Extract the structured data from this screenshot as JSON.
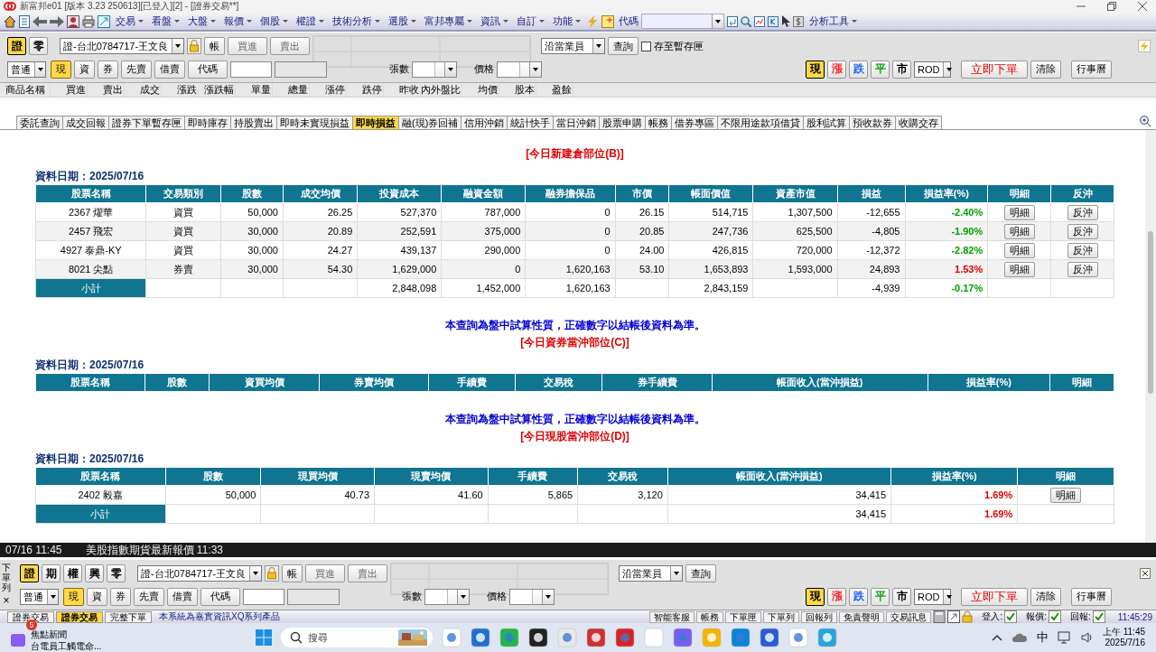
{
  "window": {
    "title": "新富邦e01 [版本 3.23 250613][已登入][2] - [證券交易**]"
  },
  "menubar": {
    "items": [
      "交易",
      "看盤",
      "大盤",
      "報價",
      "個股",
      "權證",
      "技術分析",
      "選股",
      "富邦專屬",
      "資訊",
      "自訂",
      "功能"
    ],
    "code_label": "代碼",
    "tools": "分析工具"
  },
  "order_panels": [
    {
      "markets": [
        {
          "label": "證",
          "selected": true
        },
        {
          "label": "零",
          "selected": false
        }
      ],
      "account": "證-台北0784717-王文良",
      "account_button": "帳",
      "buy": "買進",
      "sell": "賣出",
      "salesperson": "沿當業員",
      "query": "查詢",
      "save_draft": {
        "label": "存至暫存匣",
        "checked": false
      },
      "order_type": "普通",
      "trade_types": [
        {
          "label": "現",
          "selected": true
        },
        {
          "label": "資",
          "selected": false
        },
        {
          "label": "券",
          "selected": false
        },
        {
          "label": "先賣",
          "selected": false
        },
        {
          "label": "借賣",
          "selected": false
        }
      ],
      "code_button": "代碼",
      "qty_label": "張數",
      "price_label": "價格",
      "price_types": [
        {
          "label": "現",
          "selected": true,
          "color": "#000000"
        },
        {
          "label": "漲",
          "selected": false,
          "color": "#ff2020"
        },
        {
          "label": "跌",
          "selected": false,
          "color": "#2060ff"
        },
        {
          "label": "平",
          "selected": false,
          "color": "#10a010"
        },
        {
          "label": "市",
          "selected": false,
          "color": "#000000"
        }
      ],
      "tif": "ROD",
      "submit": "立即下單",
      "clear": "清除",
      "calendar": "行事曆"
    },
    {
      "label": "下單列",
      "close": "×",
      "markets": [
        {
          "label": "證",
          "selected": true
        },
        {
          "label": "期",
          "selected": false
        },
        {
          "label": "權",
          "selected": false
        },
        {
          "label": "興",
          "selected": false
        },
        {
          "label": "零",
          "selected": false
        }
      ],
      "account": "證-台北0784717-王文良",
      "account_button": "帳",
      "buy": "買進",
      "sell": "賣出",
      "salesperson": "沿當業員",
      "query": "查詢",
      "order_type": "普通",
      "trade_types": [
        {
          "label": "現",
          "selected": true
        },
        {
          "label": "資",
          "selected": false
        },
        {
          "label": "券",
          "selected": false
        },
        {
          "label": "先賣",
          "selected": false
        },
        {
          "label": "借賣",
          "selected": false
        }
      ],
      "code_button": "代碼",
      "qty_label": "張數",
      "price_label": "價格",
      "price_types": [
        {
          "label": "現",
          "selected": true,
          "color": "#000000"
        },
        {
          "label": "漲",
          "selected": false,
          "color": "#ff2020"
        },
        {
          "label": "跌",
          "selected": false,
          "color": "#2060ff"
        },
        {
          "label": "平",
          "selected": false,
          "color": "#10a010"
        },
        {
          "label": "市",
          "selected": false,
          "color": "#000000"
        }
      ],
      "tif": "ROD",
      "submit": "立即下單",
      "clear": "清除",
      "calendar": "行事曆"
    }
  ],
  "quote_columns": [
    "商品名稱",
    "買進",
    "賣出",
    "成交",
    "漲跌",
    "漲跌幅",
    "單量",
    "總量",
    "漲停",
    "跌停",
    "昨收",
    "內外盤比",
    "均價",
    "股本",
    "盈餘"
  ],
  "tabs": [
    {
      "label": "委託查詢",
      "selected": false
    },
    {
      "label": "成交回報",
      "selected": false
    },
    {
      "label": "證券下單暫存匣",
      "selected": false
    },
    {
      "label": "即時庫存",
      "selected": false
    },
    {
      "label": "持股賣出",
      "selected": false
    },
    {
      "label": "即時未實現損益",
      "selected": false
    },
    {
      "label": "即時損益",
      "selected": true
    },
    {
      "label": "融(現)券回補",
      "selected": false
    },
    {
      "label": "信用沖銷",
      "selected": false
    },
    {
      "label": "統計快手",
      "selected": false
    },
    {
      "label": "當日沖銷",
      "selected": false
    },
    {
      "label": "股票申購",
      "selected": false
    },
    {
      "label": "帳務",
      "selected": false
    },
    {
      "label": "借券專區",
      "selected": false
    },
    {
      "label": "不限用途款項借貸",
      "selected": false
    },
    {
      "label": "股利試算",
      "selected": false
    },
    {
      "label": "預收款券",
      "selected": false
    },
    {
      "label": "收購交存",
      "selected": false
    }
  ],
  "sections": [
    {
      "title": "[今日新建倉部位(B)]",
      "date": "資料日期：2025/07/16",
      "columns": [
        "股票名稱",
        "交易類別",
        "股數",
        "成交均價",
        "投資成本",
        "融資金額",
        "融券擔保品",
        "市價",
        "帳面價值",
        "資產市值",
        "損益",
        "損益率(%)",
        "明細",
        "反沖"
      ],
      "rows": [
        {
          "cells": [
            "2367 燿華",
            "資買",
            "50,000",
            "26.25",
            "527,370",
            "787,000",
            "0",
            "26.15",
            "514,715",
            "1,307,500",
            "-12,655",
            "-2.40%"
          ],
          "color": "#00a000",
          "buttons": [
            "明細",
            "反沖"
          ]
        },
        {
          "cells": [
            "2457 飛宏",
            "資買",
            "30,000",
            "20.89",
            "252,591",
            "375,000",
            "0",
            "20.85",
            "247,736",
            "625,500",
            "-4,805",
            "-1.90%"
          ],
          "color": "#00a000",
          "buttons": [
            "明細",
            "反沖"
          ]
        },
        {
          "cells": [
            "4927 泰鼎-KY",
            "資買",
            "30,000",
            "24.27",
            "439,137",
            "290,000",
            "0",
            "24.00",
            "426,815",
            "720,000",
            "-12,372",
            "-2.82%"
          ],
          "color": "#00a000",
          "buttons": [
            "明細",
            "反沖"
          ]
        },
        {
          "cells": [
            "8021 尖點",
            "券賣",
            "30,000",
            "54.30",
            "1,629,000",
            "0",
            "1,620,163",
            "53.10",
            "1,653,893",
            "1,593,000",
            "24,893",
            "1.53%"
          ],
          "color": "#e00000",
          "buttons": [
            "明細",
            "反沖"
          ]
        }
      ],
      "subtotal": {
        "cells": [
          "小計",
          null,
          null,
          null,
          "2,848,098",
          "1,452,000",
          "1,620,163",
          null,
          "2,843,159",
          null,
          "-4,939",
          "-0.17%",
          null,
          null
        ],
        "color": "#00a000"
      }
    },
    {
      "notice": "本查詢為盤中試算性質，正確數字以結帳後資料為準。",
      "title": "[今日資券當沖部位(C)]",
      "date": "資料日期：2025/07/16",
      "columns": [
        "股票名稱",
        "股數",
        "資買均價",
        "券賣均價",
        "手續費",
        "交易稅",
        "券手續費",
        "帳面收入(當沖損益)",
        "損益率(%)",
        "明細"
      ]
    },
    {
      "notice": "本查詢為盤中試算性質，正確數字以結帳後資料為準。",
      "title": "[今日現股當沖部位(D)]",
      "date": "資料日期：2025/07/16",
      "columns": [
        "股票名稱",
        "股數",
        "現買均價",
        "現賣均價",
        "手續費",
        "交易稅",
        "帳面收入(當沖損益)",
        "損益率(%)",
        "明細"
      ],
      "rows": [
        {
          "cells": [
            "2402 毅嘉",
            "50,000",
            "40.73",
            "41.60",
            "5,865",
            "3,120",
            "34,415",
            "1.69%"
          ],
          "color": "#e00000",
          "buttons": [
            "明細"
          ]
        }
      ],
      "subtotal": {
        "cells": [
          "小計",
          null,
          null,
          null,
          null,
          null,
          "34,415",
          "1.69%",
          null
        ],
        "color": "#e00000"
      }
    }
  ],
  "ticker": {
    "time": "07/16 11:45",
    "text": "美股指數期貨最新報價 11:33"
  },
  "bottom_tabs": [
    {
      "label": "證券交易",
      "selected": false
    },
    {
      "label": "證券交易",
      "selected": true
    },
    {
      "label": "完整下單",
      "selected": false
    }
  ],
  "bottom_info": "本系統為嘉實資訊XQ系列產品",
  "bottom_buttons": [
    "智能客服",
    "帳務",
    "下單匣",
    "下單列",
    "回報列",
    "免責聲明",
    "交易訊息"
  ],
  "indicators": [
    {
      "label": "登入:"
    },
    {
      "label": "報價:"
    },
    {
      "label": "回報:"
    }
  ],
  "clock": "11:45:29",
  "taskbar": {
    "news": {
      "badge": "5",
      "title": "焦點新聞",
      "text": "台電員工觸電命..."
    },
    "search": {
      "placeholder": "搜尋"
    },
    "ime": "中",
    "time": "上午 11:45",
    "date": "2025/7/16"
  }
}
